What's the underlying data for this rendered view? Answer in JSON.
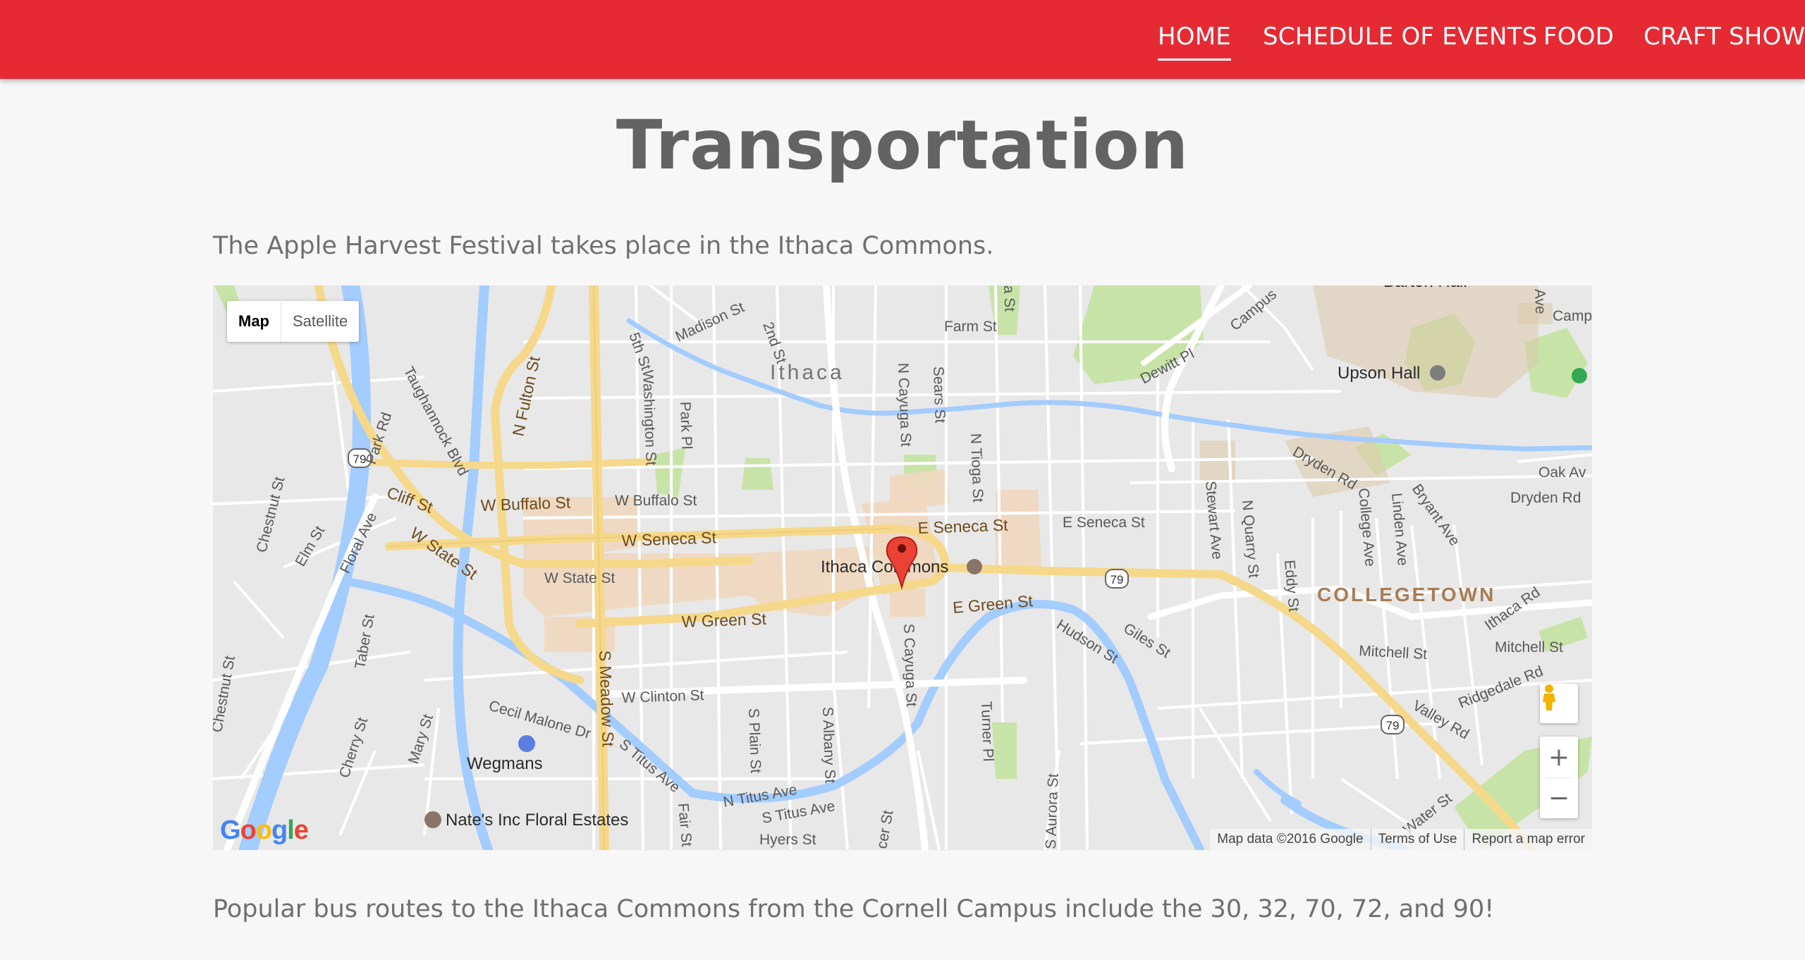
{
  "nav": {
    "home": "HOME",
    "schedule": "SCHEDULE OF EVENTS",
    "food": "FOOD",
    "craft": "CRAFT SHOW"
  },
  "page": {
    "title": "Transportation",
    "intro": "The Apple Harvest Festival takes place in the Ithaca Commons.",
    "bus_routes": "Popular bus routes to the Ithaca Commons from the Cornell Campus include the 30, 32, 70, 72, and 90!"
  },
  "map": {
    "type_map": "Map",
    "type_satellite": "Satellite",
    "zoom_in": "+",
    "zoom_out": "−",
    "logo": "Google",
    "attribution": {
      "data": "Map data ©2016 Google",
      "terms": "Terms of Use",
      "report": "Report a map error"
    },
    "marker": "Ithaca Commons",
    "labels": {
      "city": "Ithaca",
      "collegetown": "COLLEGETOWN",
      "upson": "Upson Hall",
      "burton": "Barton Hall",
      "wegmans": "Wegmans",
      "nates": "Nate's Inc Floral Estates",
      "farm": "Farm St",
      "madison": "Madison St",
      "fifth": "5th St",
      "second": "2nd St",
      "campus": "Campus",
      "camp": "Camp",
      "dewitt": "Dewitt Pl",
      "n_fulton": "N Fulton St",
      "washington": "Washington St",
      "park_pl": "Park Pl",
      "n_cayuga": "N Cayuga St",
      "sears": "Sears St",
      "n_tioga": "N Tioga St",
      "taughannock": "Taughannock Blvd",
      "park_rd": "Park Rd",
      "chestnut": "Chestnut St",
      "elm": "Elm St",
      "floral": "Floral Ave",
      "cliff": "Cliff St",
      "w_buffalo_road": "W Buffalo St",
      "w_buffalo": "W Buffalo St",
      "w_state": "W State St",
      "w_state_2": "W State St",
      "w_seneca": "W Seneca St",
      "e_seneca": "E Seneca St",
      "e_seneca_2": "E Seneca St",
      "w_green": "W Green St",
      "e_green": "E Green St",
      "stewart": "Stewart Ave",
      "n_quarry": "N Quarry St",
      "eddy": "Eddy St",
      "college": "College Ave",
      "linden": "Linden Ave",
      "bryant": "Bryant Ave",
      "dryden": "Dryden Rd",
      "dryden_2": "Dryden Rd",
      "oak": "Oak Av",
      "ithaca_rd": "Ithaca Rd",
      "mitchell": "Mitchell St",
      "mitchell_2": "Mitchell St",
      "ridgedale": "Ridgedale Rd",
      "valley": "Valley Rd",
      "hudson": "Hudson St",
      "giles": "Giles St",
      "taber": "Taber St",
      "chestnut_2": "Chestnut St",
      "cherry": "Cherry St",
      "mary": "Mary St",
      "cecil": "Cecil Malone Dr",
      "s_meadow": "S Meadow St",
      "w_clinton": "W Clinton St",
      "s_plain": "S Plain St",
      "s_albany": "S Albany St",
      "s_cayuga": "S Cayuga St",
      "turner": "Turner Pl",
      "s_titus": "S Titus Ave",
      "n_titus": "N Titus Ave",
      "s_titus_2": "S Titus Ave",
      "hyers": "Hyers St",
      "s_aurora": "S Aurora St",
      "water": "Water St",
      "fair": "Fair St",
      "cer": "cer St",
      "a_st": "a St",
      "ave": "Ave",
      "rt79": "79"
    }
  }
}
